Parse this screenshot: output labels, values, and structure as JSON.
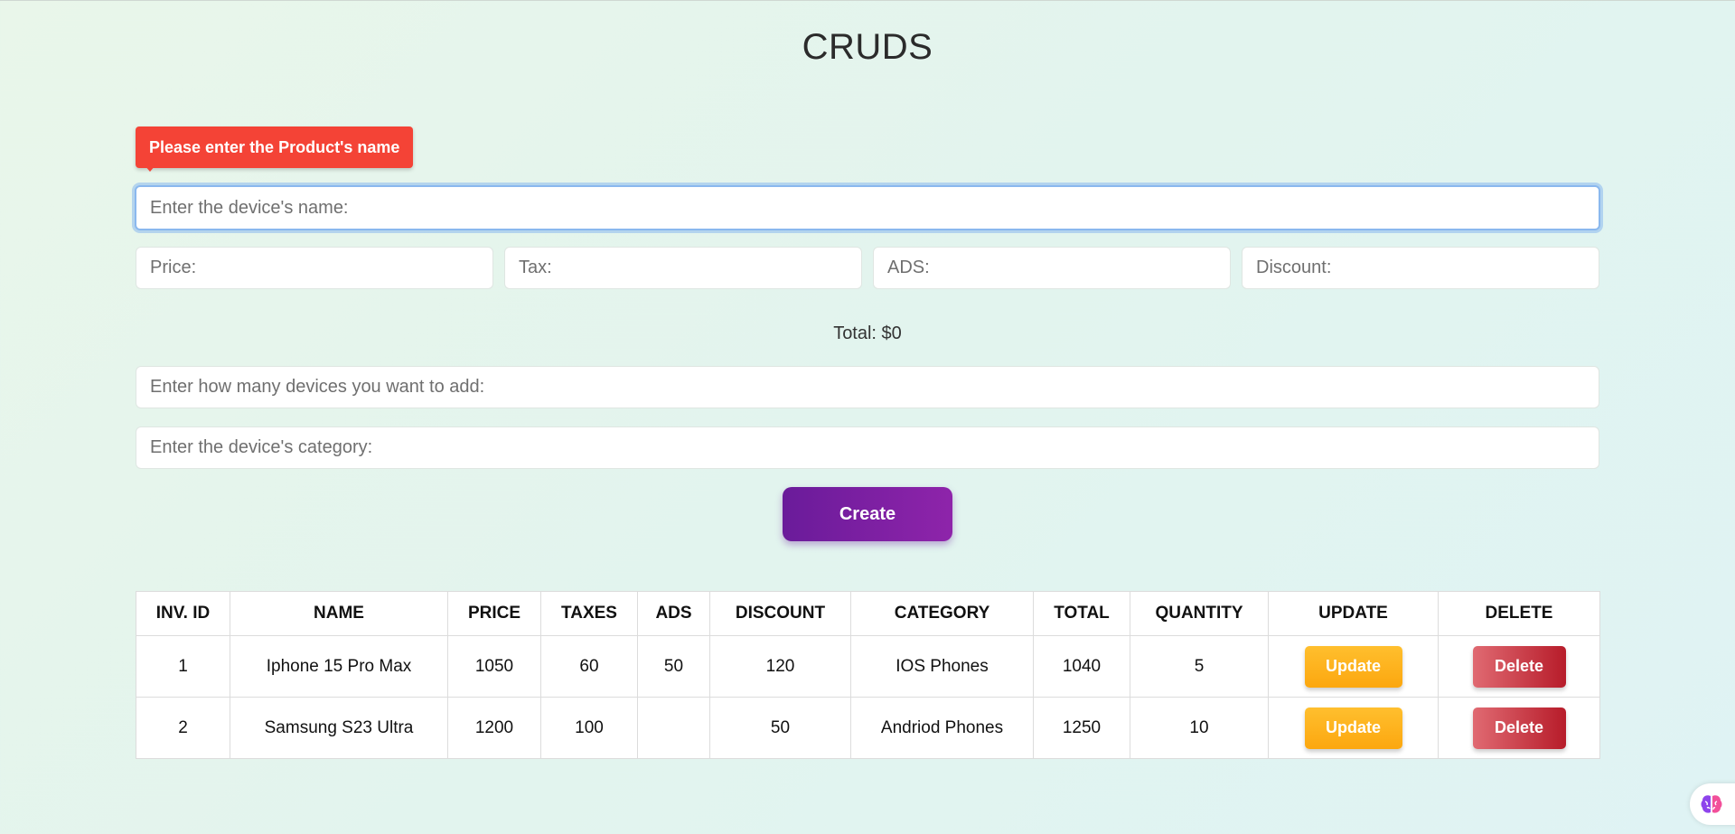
{
  "app": {
    "title": "CRUDS"
  },
  "validation": {
    "message": "Please enter the Product's name"
  },
  "form": {
    "name_placeholder": "Enter the device's name:",
    "price_placeholder": "Price:",
    "tax_placeholder": "Tax:",
    "ads_placeholder": "ADS:",
    "discount_placeholder": "Discount:",
    "total_text": "Total: $0",
    "count_placeholder": "Enter how many devices you want to add:",
    "category_placeholder": "Enter the device's category:",
    "create_label": "Create"
  },
  "table": {
    "headers": [
      "INV. ID",
      "NAME",
      "PRICE",
      "TAXES",
      "ADS",
      "DISCOUNT",
      "CATEGORY",
      "TOTAL",
      "QUANTITY",
      "UPDATE",
      "DELETE"
    ],
    "rows": [
      {
        "id": "1",
        "name": "Iphone 15 Pro Max",
        "price": "1050",
        "taxes": "60",
        "ads": "50",
        "discount": "120",
        "category": "IOS Phones",
        "total": "1040",
        "quantity": "5",
        "update_label": "Update",
        "delete_label": "Delete"
      },
      {
        "id": "2",
        "name": "Samsung S23 Ultra",
        "price": "1200",
        "taxes": "100",
        "ads": "",
        "discount": "50",
        "category": "Andriod Phones",
        "total": "1250",
        "quantity": "10",
        "update_label": "Update",
        "delete_label": "Delete"
      }
    ]
  },
  "colors": {
    "validation": "#f44336",
    "create_button": "#7b1fa2",
    "update_button": "#fbb117",
    "delete_button": "#c62828",
    "focus_ring": "#8ab8ee"
  },
  "icons": {
    "corner_badge": "brain-icon"
  }
}
